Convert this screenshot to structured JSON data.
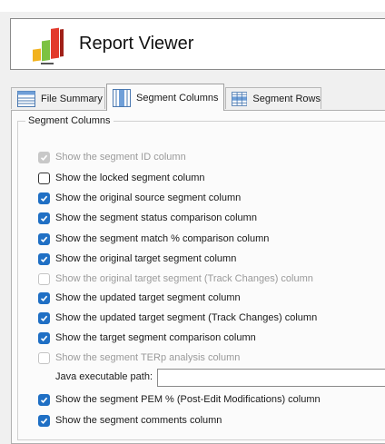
{
  "app": {
    "title": "Report Viewer"
  },
  "tabs": [
    {
      "label": "File Summary",
      "icon": "file-summary-icon"
    },
    {
      "label": "Segment Columns",
      "icon": "segment-columns-icon",
      "active": true
    },
    {
      "label": "Segment Rows",
      "icon": "segment-rows-icon"
    }
  ],
  "group": {
    "title": "Segment Columns"
  },
  "options": [
    {
      "label": "Show the segment ID column",
      "checked": true,
      "disabled": true
    },
    {
      "label": "Show the locked segment column",
      "checked": false,
      "disabled": false
    },
    {
      "label": "Show the original source segment column",
      "checked": true,
      "disabled": false
    },
    {
      "label": "Show the segment status comparison column",
      "checked": true,
      "disabled": false
    },
    {
      "label": "Show the segment match % comparison column",
      "checked": true,
      "disabled": false
    },
    {
      "label": "Show the original target segment column",
      "checked": true,
      "disabled": false
    },
    {
      "label": "Show the original target segment (Track Changes) column",
      "checked": false,
      "disabled": true
    },
    {
      "label": "Show the updated target segment column",
      "checked": true,
      "disabled": false
    },
    {
      "label": "Show the updated target segment (Track Changes) column",
      "checked": true,
      "disabled": false
    },
    {
      "label": "Show the target segment comparison column",
      "checked": true,
      "disabled": false
    },
    {
      "label": "Show the segment TERp analysis column",
      "checked": false,
      "disabled": true
    },
    {
      "label": "Show the segment PEM % (Post-Edit Modifications) column",
      "checked": true,
      "disabled": false
    },
    {
      "label": "Show the segment comments column",
      "checked": true,
      "disabled": false
    }
  ],
  "java": {
    "label": "Java executable path:",
    "value": "",
    "placeholder": ""
  },
  "colors": {
    "accent": "#1f6fc4",
    "panel": "#f0f0f0"
  }
}
